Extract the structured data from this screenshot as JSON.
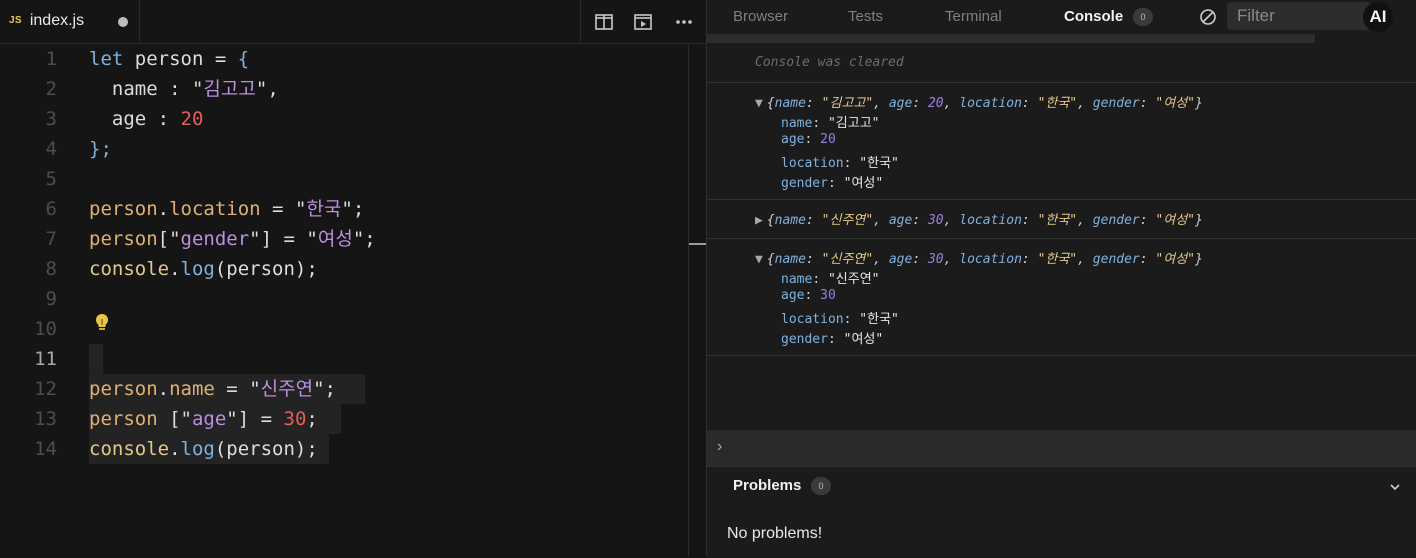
{
  "editor": {
    "tab": {
      "badge": "JS",
      "filename": "index.js"
    },
    "actions": [
      "split-editor",
      "preview",
      "more"
    ],
    "lines": [
      {
        "n": "1"
      },
      {
        "n": "2"
      },
      {
        "n": "3"
      },
      {
        "n": "4"
      },
      {
        "n": "5"
      },
      {
        "n": "6"
      },
      {
        "n": "7"
      },
      {
        "n": "8"
      },
      {
        "n": "9"
      },
      {
        "n": "10"
      },
      {
        "n": "11"
      },
      {
        "n": "12"
      },
      {
        "n": "13"
      },
      {
        "n": "14"
      }
    ],
    "code": {
      "l1": {
        "kw": "let",
        "ident": " person ",
        "op": "= ",
        "brace": "{"
      },
      "l2": {
        "key": "  name",
        "colon": " : ",
        "q1": "\"",
        "str": "김고고",
        "q2": "\"",
        "comma": ","
      },
      "l3": {
        "key": "  age",
        "colon": " : ",
        "num": "20"
      },
      "l4": {
        "text": "};"
      },
      "l6": {
        "obj": "person",
        "dot": ".",
        "prop": "location",
        "op": " = ",
        "q1": "\"",
        "str": "한국",
        "q2": "\"",
        "end": ";"
      },
      "l7": {
        "obj": "person",
        "b1": "[\"",
        "str": "gender",
        "b2": "\"]",
        "op": " = ",
        "q1": "\"",
        "str2": "여성",
        "q2": "\"",
        "end": ";"
      },
      "l8": {
        "obj": "console",
        "dot": ".",
        "fn": "log",
        "args": "(person);"
      },
      "l12": {
        "obj": "person",
        "dot": ".",
        "prop": "name",
        "op": " = ",
        "q1": "\"",
        "str": "신주연",
        "q2": "\"",
        "end": ";"
      },
      "l13": {
        "obj": "person ",
        "b1": "[\"",
        "str": "age",
        "b2": "\"]",
        "op": " = ",
        "num": "30",
        "end": ";"
      },
      "l14": {
        "obj": "console",
        "dot": ".",
        "fn": "log",
        "args": "(person);"
      }
    }
  },
  "panel": {
    "tabs": {
      "browser": "Browser",
      "tests": "Tests",
      "terminal": "Terminal",
      "console": "Console",
      "console_count": "0"
    },
    "filter_placeholder": "Filter",
    "ai_label": "AI",
    "cleared_msg": "Console was cleared",
    "entries": [
      {
        "expanded": true,
        "summary": {
          "name": "\"김고고\"",
          "age": "20",
          "location": "\"한국\"",
          "gender": "\"여성\""
        },
        "props": {
          "name": "\"김고고\"",
          "age": "20",
          "location": "\"한국\"",
          "gender": "\"여성\""
        }
      },
      {
        "expanded": false,
        "summary": {
          "name": "\"신주연\"",
          "age": "30",
          "location": "\"한국\"",
          "gender": "\"여성\""
        }
      },
      {
        "expanded": true,
        "summary": {
          "name": "\"신주연\"",
          "age": "30",
          "location": "\"한국\"",
          "gender": "\"여성\""
        },
        "props": {
          "name": "\"신주연\"",
          "age": "30",
          "location": "\"한국\"",
          "gender": "\"여성\""
        }
      }
    ],
    "prompt": "›",
    "problems": {
      "title": "Problems",
      "count": "0",
      "message": "No problems!"
    }
  },
  "keys": {
    "name": "name",
    "age": "age",
    "location": "location",
    "gender": "gender"
  },
  "colors": {
    "keyword": "#7fb1de",
    "string": "#bc8fdf",
    "number": "#e0605c",
    "property": "#dfb071"
  }
}
